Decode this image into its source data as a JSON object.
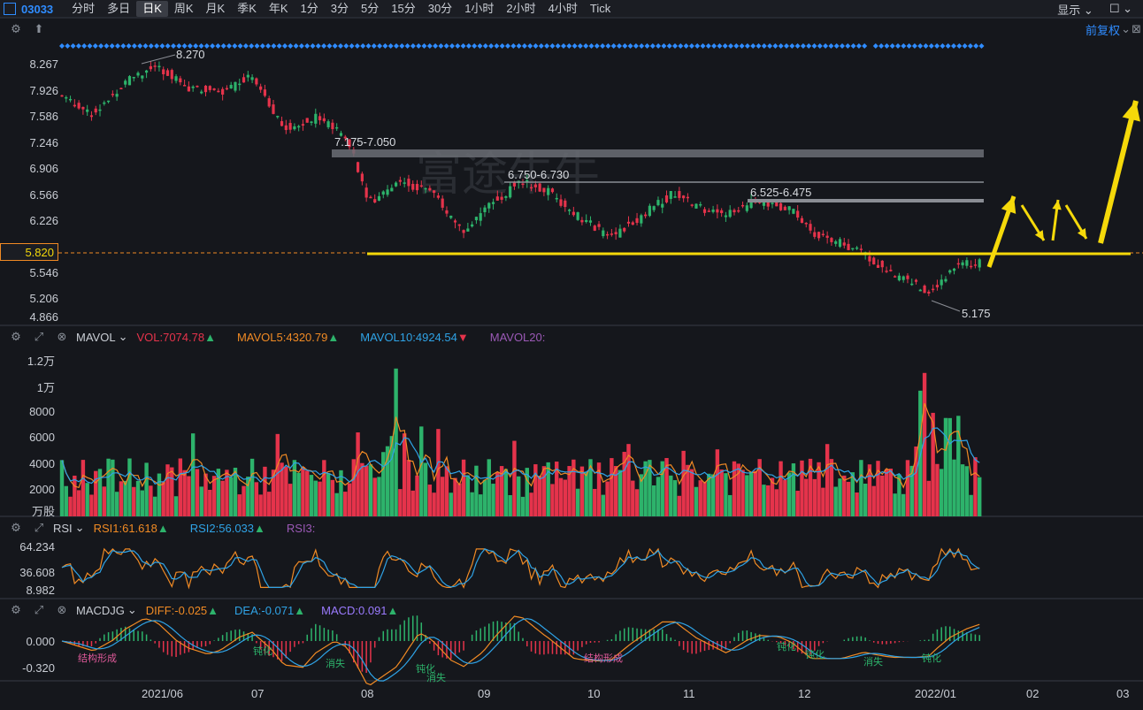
{
  "toolbar": {
    "ticker": "03033",
    "tabs": [
      "分时",
      "多日",
      "日K",
      "周K",
      "月K",
      "季K",
      "年K",
      "1分",
      "3分",
      "5分",
      "15分",
      "30分",
      "1小时",
      "2小时",
      "4小时",
      "Tick"
    ],
    "active_tab": "日K",
    "display_label": "显示"
  },
  "main_panel": {
    "adjust_label": "前复权",
    "price_ticks": [
      "8.267",
      "7.926",
      "7.586",
      "7.246",
      "6.906",
      "6.566",
      "6.226",
      "5.820",
      "5.546",
      "5.206",
      "4.866"
    ],
    "current_price": "5.820",
    "high_label": "8.270",
    "low_label": "5.175",
    "zones": [
      "7.175-7.050",
      "6.750-6.730",
      "6.525-6.475"
    ],
    "watermark": "富途牛牛"
  },
  "vol_panel": {
    "name": "MAVOL",
    "vol": "VOL:7074.78",
    "mavol5": "MAVOL5:4320.79",
    "mavol10": "MAVOL10:4924.54",
    "mavol20": "MAVOL20:",
    "ticks": [
      "1.2万",
      "1万",
      "8000",
      "6000",
      "4000",
      "2000",
      "万股"
    ]
  },
  "rsi_panel": {
    "name": "RSI",
    "rsi1": "RSI1:61.618",
    "rsi2": "RSI2:56.033",
    "rsi3": "RSI3:",
    "ticks": [
      "64.234",
      "36.608",
      "8.982"
    ]
  },
  "macd_panel": {
    "name": "MACDJG",
    "diff": "DIFF:-0.025",
    "dea": "DEA:-0.071",
    "macd": "MACD:0.091",
    "ticks": [
      "0.000",
      "-0.320"
    ],
    "annotations": [
      "结构形成",
      "钝化",
      "消失",
      "钝化",
      "消失",
      "结构形成",
      "钝化",
      "钝化",
      "消失",
      "钝化"
    ]
  },
  "x_axis": [
    "2021/06",
    "07",
    "08",
    "09",
    "10",
    "11",
    "12",
    "2022/01",
    "02",
    "03"
  ],
  "colors": {
    "up": "#2db36b",
    "down": "#e5334b",
    "accent": "#2f8cff",
    "support": "#f5d90a",
    "ma5": "#f08a24",
    "ma10": "#2fa3e6",
    "ma20": "#9b59b6"
  }
}
